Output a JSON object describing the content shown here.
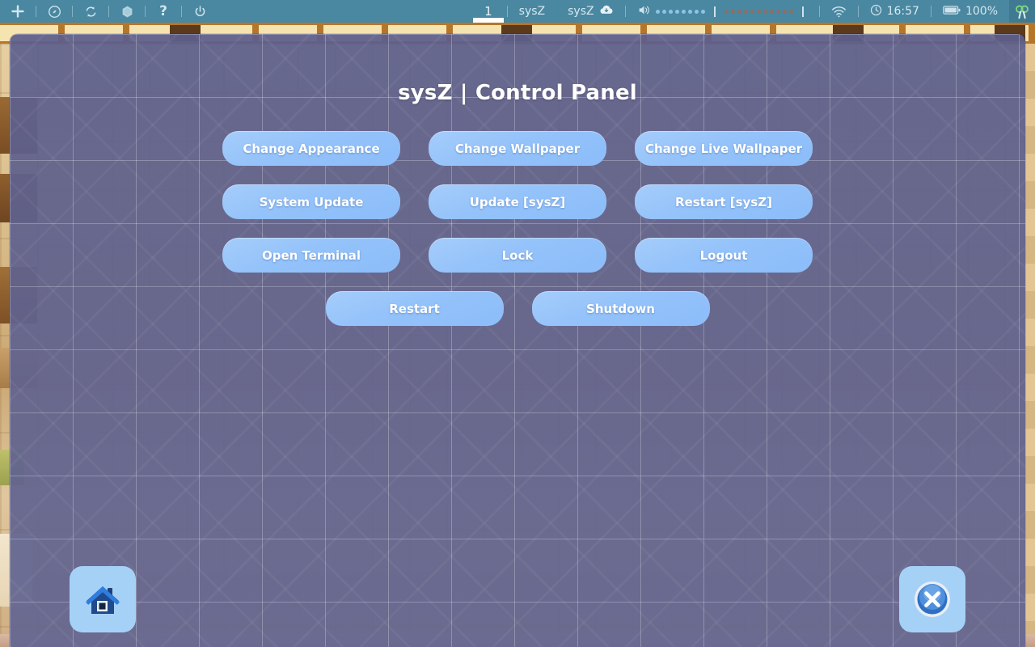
{
  "topbar": {
    "left_buttons": [
      {
        "name": "add-icon",
        "glyph": "+"
      },
      {
        "name": "compass-icon",
        "glyph": "◎"
      },
      {
        "name": "refresh-icon",
        "glyph": "↻"
      },
      {
        "name": "package-icon",
        "glyph": "⬢"
      },
      {
        "name": "help-icon",
        "glyph": "?"
      },
      {
        "name": "power-icon",
        "glyph": "⏻"
      }
    ],
    "workspace": "1",
    "window_title": "sysZ",
    "update_label": "sysZ",
    "update_icon": "cloud-download-icon",
    "volume_icon": "speaker-icon",
    "volume_filled_dots": 8,
    "volume_empty_dots": 11,
    "wifi_icon": "wifi-icon",
    "clock_icon": "clock-icon",
    "clock": "16:57",
    "battery_icon": "battery-icon",
    "battery": "100%",
    "corner_icon": "mascot-icon"
  },
  "panel": {
    "title": "sysZ | Control Panel",
    "rows": [
      [
        {
          "label": "Change Appearance",
          "name": "change-appearance-button"
        },
        {
          "label": "Change Wallpaper",
          "name": "change-wallpaper-button"
        },
        {
          "label": "Change Live Wallpaper",
          "name": "change-live-wallpaper-button"
        }
      ],
      [
        {
          "label": "System Update",
          "name": "system-update-button"
        },
        {
          "label": "Update [sysZ]",
          "name": "update-sysz-button"
        },
        {
          "label": "Restart [sysZ]",
          "name": "restart-sysz-button"
        }
      ],
      [
        {
          "label": "Open Terminal",
          "name": "open-terminal-button"
        },
        {
          "label": "Lock",
          "name": "lock-button"
        },
        {
          "label": "Logout",
          "name": "logout-button"
        }
      ],
      [
        {
          "label": "Restart",
          "name": "restart-button"
        },
        {
          "label": "Shutdown",
          "name": "shutdown-button"
        }
      ]
    ]
  },
  "desktop_icons": {
    "home": {
      "name": "home-icon",
      "label": "Home"
    },
    "close": {
      "name": "close-icon",
      "label": "Close"
    }
  },
  "colors": {
    "topbar_bg": "#4a87a0",
    "panel_bg": "#5d5f8c",
    "button_bg": "#94c2fa",
    "button_text": "#ffffff",
    "icon_tile_bg": "#a6d1f7",
    "wallpaper_wood": "#b5762a"
  }
}
